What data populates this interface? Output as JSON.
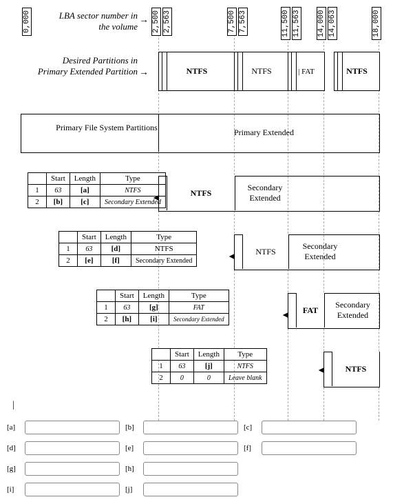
{
  "lba_label": "LBA sector number in the volume",
  "desired_label": "Desired Partitions in Primary Extended Partition",
  "ticks": {
    "t0": "0,000",
    "t2500": "2,500",
    "t2563": "2,563",
    "t7500": "7,500",
    "t7563": "7,563",
    "t11500": "11,500",
    "t11563": "11,563",
    "t14000": "14,000",
    "t14063": "14,063",
    "t18000": "18,000"
  },
  "desired_parts": {
    "p1": "NTFS",
    "p2": "NTFS",
    "p3": "FAT",
    "p4": "NTFS"
  },
  "primary_row": {
    "left": "Primary File System Partitions",
    "right": "Primary Extended"
  },
  "sec_label": "Secondary Extended",
  "tables": {
    "headers": {
      "start": "Start",
      "length": "Length",
      "type": "Type"
    },
    "t1": {
      "r1": {
        "idx": "1",
        "start": "63",
        "length": "[a]",
        "type": "NTFS"
      },
      "r2": {
        "idx": "2",
        "start": "[b]",
        "length": "[c]",
        "type": "Secondary Extended"
      }
    },
    "t2": {
      "r1": {
        "idx": "1",
        "start": "63",
        "length": "[d]",
        "type": "NTFS"
      },
      "r2": {
        "idx": "2",
        "start": "[e]",
        "length": "[f]",
        "type": "Secondary Extended"
      }
    },
    "t3": {
      "r1": {
        "idx": "1",
        "start": "63",
        "length": "[g]",
        "type": "FAT"
      },
      "r2": {
        "idx": "2",
        "start": "[h]",
        "length": "[i]",
        "type": "Secondary Extended"
      }
    },
    "t4": {
      "r1": {
        "idx": "1",
        "start": "63",
        "length": "[j]",
        "type": "NTFS"
      },
      "r2": {
        "idx": "2",
        "start": "0",
        "length": "0",
        "type": "Leave blank"
      }
    }
  },
  "part_labels": {
    "ntfs": "NTFS",
    "fat": "FAT"
  },
  "answers": {
    "a": "[a]",
    "b": "[b]",
    "c": "[c]",
    "d": "[d]",
    "e": "[e]",
    "f": "[f]",
    "g": "[g]",
    "h": "[h]",
    "i": "[i]",
    "j": "[j]"
  }
}
